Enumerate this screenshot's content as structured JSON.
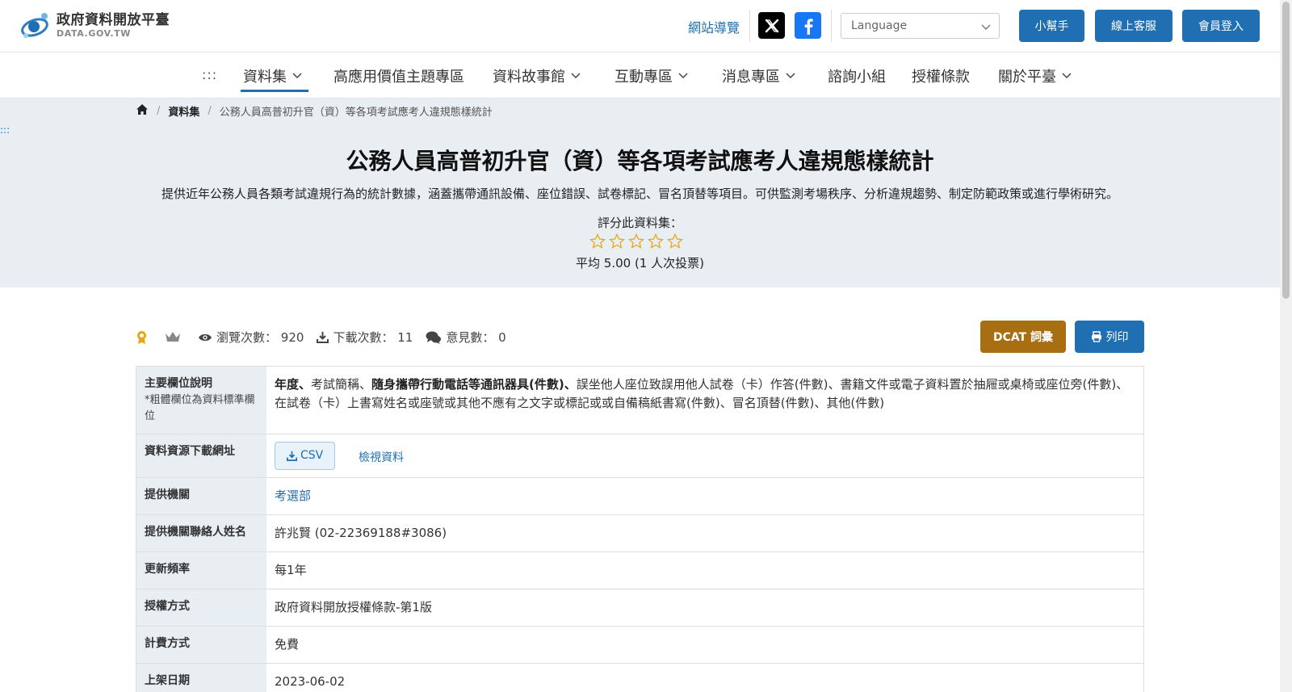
{
  "header": {
    "logo_title": "政府資料開放平臺",
    "logo_sub": "DATA.GOV.TW",
    "site_nav": "網站導覽",
    "language_placeholder": "Language",
    "buttons": {
      "helper": "小幫手",
      "service": "線上客服",
      "login": "會員登入"
    }
  },
  "nav": {
    "dots": ":::",
    "items": [
      "資料集",
      "高應用價值主題專區",
      "資料故事館",
      "互動專區",
      "消息專區",
      "諮詢小組",
      "授權條款",
      "關於平臺"
    ]
  },
  "breadcrumb": {
    "dataset": "資料集",
    "current": "公務人員高普初升官（資）等各項考試應考人違規態樣統計"
  },
  "skip_dots": ":::",
  "hero": {
    "title": "公務人員高普初升官（資）等各項考試應考人違規態樣統計",
    "description": "提供近年公務人員各類考試違規行為的統計數據，涵蓋攜帶通訊設備、座位錯誤、試卷標記、冒名頂替等項目。可供監測考場秩序、分析違規趨勢、制定防範政策或進行學術研究。",
    "rate_label": "評分此資料集：",
    "stars_filled": 0,
    "stars_total": 5,
    "rate_avg": "平均 5.00 (1 人次投票)",
    "star_color": "#e6a817"
  },
  "stats": {
    "views_label": "瀏覽次數：",
    "views": "920",
    "downloads_label": "下載次數：",
    "downloads": "11",
    "comments_label": "意見數：",
    "comments": "0",
    "dcat": "DCAT 詞彙",
    "print": "列印"
  },
  "table": {
    "fields_label": "主要欄位說明",
    "fields_note": "*粗體欄位為資料標準欄位",
    "fields": [
      {
        "text": "年度",
        "bold": true
      },
      {
        "text": "、",
        "bold": true
      },
      {
        "text": "考試簡稱、",
        "bold": false
      },
      {
        "text": "隨身攜帶行動電話等通訊器具(件數)",
        "bold": true
      },
      {
        "text": "、",
        "bold": true
      },
      {
        "text": "誤坐他人座位致誤用他人試卷（卡）作答(件數)、書籍文件或電子資料置於抽屜或桌椅或座位旁(件數)、在試卷（卡）上書寫姓名或座號或其他不應有之文字或標記或或自備稿紙書寫(件數)、冒名頂替(件數)、其他(件數)",
        "bold": false
      }
    ],
    "download_label": "資料資源下載網址",
    "csv": "CSV",
    "view_data": "檢視資料",
    "provider_label": "提供機關",
    "provider": "考選部",
    "contact_label": "提供機關聯絡人姓名",
    "contact": "許兆賢 (02-22369188#3086)",
    "freq_label": "更新頻率",
    "freq": "每1年",
    "license_label": "授權方式",
    "license": "政府資料開放授權條款-第1版",
    "fee_label": "計費方式",
    "fee": "免費",
    "date_label": "上架日期",
    "date": "2023-06-02"
  }
}
